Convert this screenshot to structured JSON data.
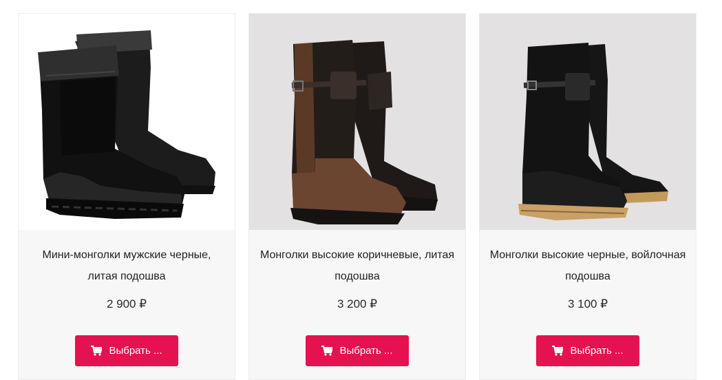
{
  "products": [
    {
      "title_line1": "Мини-монголки мужские черные,",
      "title_line2": "литая подошва",
      "price": "2 900 ₽",
      "button_label": "Выбрать ...",
      "image_background": "#ffffff"
    },
    {
      "title_line1": "Монголки высокие коричневые, литая",
      "title_line2": "подошва",
      "price": "3 200 ₽",
      "button_label": "Выбрать ...",
      "image_background": "#e3e1e1"
    },
    {
      "title_line1": "Монголки высокие черные, войлочная",
      "title_line2": "подошва",
      "price": "3 100 ₽",
      "button_label": "Выбрать ...",
      "image_background": "#e3e1e1"
    }
  ],
  "colors": {
    "accent": "#e5124f",
    "card_background": "#f7f7f7"
  },
  "icons": {
    "button_icon": "cart-icon"
  }
}
